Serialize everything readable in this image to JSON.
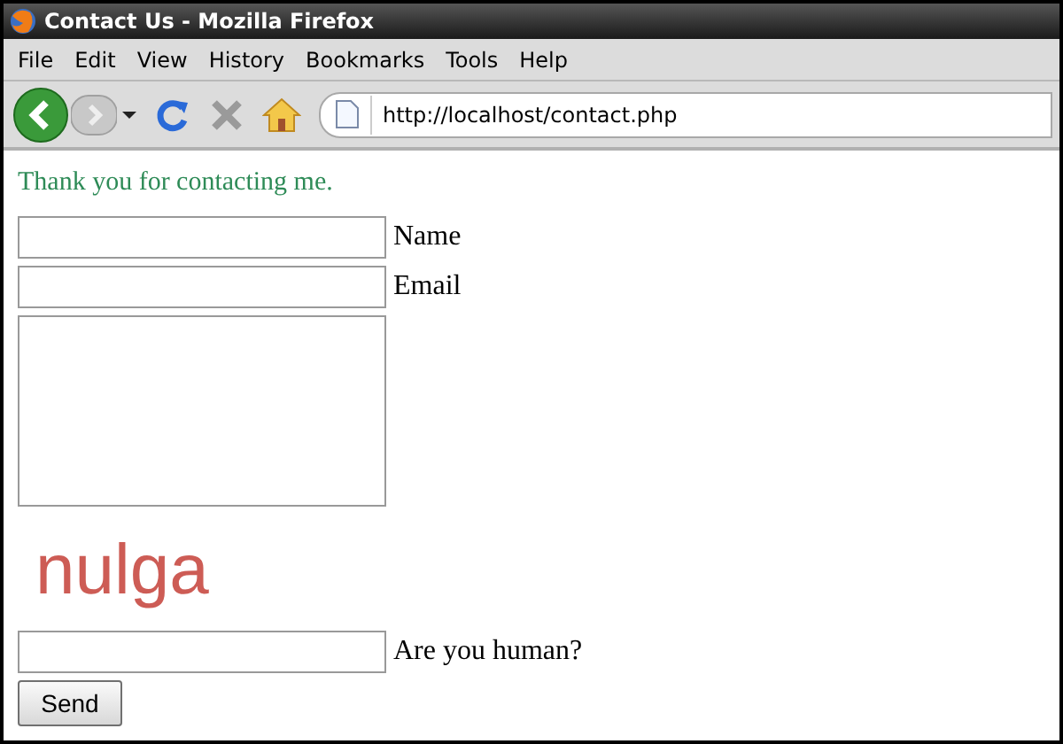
{
  "window": {
    "title": "Contact Us - Mozilla Firefox"
  },
  "menu": [
    "File",
    "Edit",
    "View",
    "History",
    "Bookmarks",
    "Tools",
    "Help"
  ],
  "address": {
    "url": "http://localhost/contact.php"
  },
  "page": {
    "message": "Thank you for contacting me.",
    "fields": [
      {
        "kind": "input",
        "label": "Name"
      },
      {
        "kind": "input",
        "label": "Email"
      },
      {
        "kind": "textarea"
      }
    ],
    "captcha": {
      "text": "nulga",
      "label": "Are you human?"
    },
    "button": "Send"
  }
}
